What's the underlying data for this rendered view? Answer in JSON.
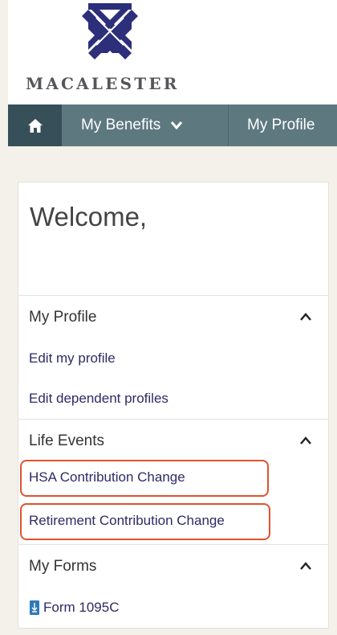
{
  "brand": {
    "name": "MACALESTER"
  },
  "nav": {
    "home_icon": "home-icon",
    "benefits_label": "My Benefits",
    "profile_label": "My Profile"
  },
  "welcome": {
    "text": "Welcome,"
  },
  "sections": [
    {
      "title": "My Profile",
      "links": [
        "Edit my profile",
        "Edit dependent profiles"
      ]
    },
    {
      "title": "Life Events",
      "links": [
        "HSA Contribution Change",
        "Retirement Contribution Change"
      ]
    },
    {
      "title": "My Forms",
      "links": [
        "Form 1095C"
      ]
    }
  ],
  "colors": {
    "nav_bg": "#5e7880",
    "nav_home_bg": "#374f59",
    "link": "#2e2a66",
    "highlight": "#e0532d",
    "logo": "#2d2f7a"
  }
}
